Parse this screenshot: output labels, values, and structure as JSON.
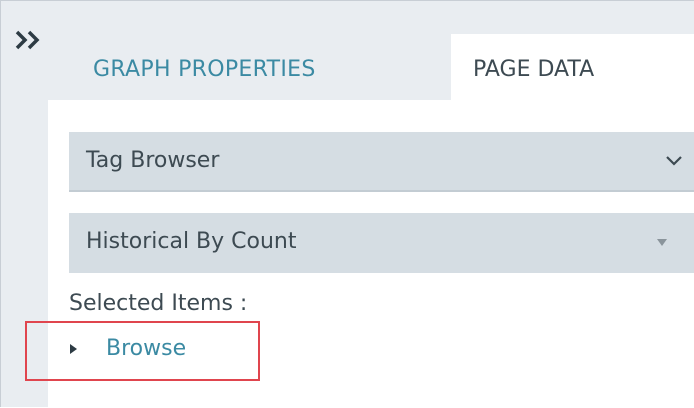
{
  "sidebar": {
    "collapse_icon": "double-chevron-right-icon"
  },
  "tabs": [
    {
      "label": "GRAPH PROPERTIES",
      "active": false
    },
    {
      "label": "PAGE DATA",
      "active": true
    }
  ],
  "page_data": {
    "source_select": {
      "value": "Tag Browser",
      "icon": "chevron-down-icon"
    },
    "mode_select": {
      "value": "Historical By Count",
      "icon": "triangle-down-icon"
    },
    "selected_items_label": "Selected Items :",
    "browse": {
      "label": "Browse",
      "icon": "caret-right-icon"
    }
  },
  "colors": {
    "accent": "#3b8aa3",
    "panel_bg": "#e9edf1",
    "select_bg": "#d5dde3",
    "highlight": "#e0454e"
  }
}
